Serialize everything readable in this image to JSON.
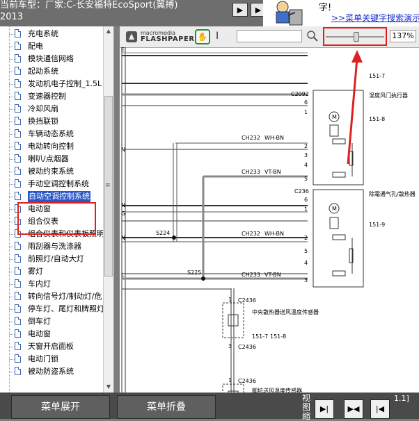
{
  "header": {
    "car_title": "当前车型：厂家:C-长安福特EcoSport(翼搏)",
    "year": "2013",
    "buttons": [
      "▶",
      "▶"
    ]
  },
  "promo": {
    "text": "字!",
    "link": ">>菜单关键字搜索演示"
  },
  "sidebar": {
    "items": [
      {
        "label": "充电系统"
      },
      {
        "label": "配电"
      },
      {
        "label": "模块通信网络"
      },
      {
        "label": "起动系统"
      },
      {
        "label": "发动机电子控制_1.5L"
      },
      {
        "label": "变速器控制"
      },
      {
        "label": "冷却风扇"
      },
      {
        "label": "换挡联锁"
      },
      {
        "label": "车辆动态系统"
      },
      {
        "label": "电动转向控制"
      },
      {
        "label": "喇叭/点烟器"
      },
      {
        "label": "被动约束系统"
      },
      {
        "label": "手动空调控制系统"
      },
      {
        "label": "自动空调控制系统",
        "selected": true
      },
      {
        "label": "电动窗"
      },
      {
        "label": "组合仪表"
      },
      {
        "label": "组合仪表和仪表板照明"
      },
      {
        "label": "雨刮器与洗涤器"
      },
      {
        "label": "前照灯/自动大灯"
      },
      {
        "label": "雾灯"
      },
      {
        "label": "车内灯"
      },
      {
        "label": "转向信号灯/制动灯/危"
      },
      {
        "label": "停车灯、尾灯和牌照灯"
      },
      {
        "label": "倒车灯"
      },
      {
        "label": "电动窗"
      },
      {
        "label": "天窗开启面板"
      },
      {
        "label": "电动门锁"
      },
      {
        "label": "被动防盗系统"
      }
    ]
  },
  "viewer": {
    "logo_top": "macromedia",
    "logo_bottom": "FLASHPAPER",
    "search_value": "",
    "zoom": "137%",
    "zoom_level": 0.52,
    "accent": "#e02020"
  },
  "diagram": {
    "labels": {
      "c2092": "C2092",
      "actuator1": "混度风门执行器",
      "ref1": "151-8",
      "ref_top": "151-7",
      "ch232_top": "CH232",
      "wh_bn_top": "WH-BN",
      "ch233_top": "CH233",
      "vt_bn_top": "VT-BN",
      "c236": "C236",
      "actuator2": "除霜通气孔/散热器",
      "ref2": "151-9",
      "s224": "S224",
      "s225": "S225",
      "ch232_bot": "CH232",
      "wh_bn_bot": "WH-BN",
      "ch233_bot": "CH233",
      "vt_bn_bot": "VT-BN",
      "c2436a": "C2436",
      "c2436b": "C2436",
      "sensor1": "中央散热器送风温度传感器",
      "sensor1_ref_a": "151-7",
      "sensor1_ref_b": "151-8",
      "c2436c": "C2436",
      "sensor2": "脚坑送风温度传感器",
      "pin_e": "E",
      "pin_n1": "N",
      "pin_n2": "N",
      "pin_n3": "N",
      "pin_g": "G",
      "pin_l": "L"
    },
    "pins_top": [
      "6",
      "1",
      "2",
      "3",
      "4",
      "5"
    ],
    "pins_mid": [
      "6",
      "1",
      "2",
      "5",
      "4",
      "3"
    ]
  },
  "bottombar": {
    "expand_label": "菜单展开",
    "collapse_label": "菜单折叠",
    "view_label": "视图缩",
    "page_indicator": "1.1]"
  }
}
